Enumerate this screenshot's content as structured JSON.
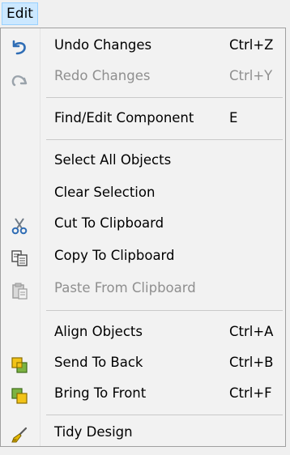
{
  "menubar": {
    "title": "Edit"
  },
  "menu": {
    "items": [
      {
        "label": "Undo Changes",
        "shortcut": "Ctrl+Z",
        "icon": "undo-icon",
        "enabled": true
      },
      {
        "label": "Redo Changes",
        "shortcut": "Ctrl+Y",
        "icon": "redo-icon",
        "enabled": false
      },
      {
        "label": "Find/Edit Component",
        "shortcut": "E",
        "icon": "",
        "enabled": true
      },
      {
        "label": "Select All Objects",
        "shortcut": "",
        "icon": "",
        "enabled": true
      },
      {
        "label": "Clear Selection",
        "shortcut": "",
        "icon": "",
        "enabled": true
      },
      {
        "label": "Cut To Clipboard",
        "shortcut": "",
        "icon": "cut-icon",
        "enabled": true
      },
      {
        "label": "Copy To Clipboard",
        "shortcut": "",
        "icon": "copy-icon",
        "enabled": true
      },
      {
        "label": "Paste From Clipboard",
        "shortcut": "",
        "icon": "paste-icon",
        "enabled": false
      },
      {
        "label": "Align Objects",
        "shortcut": "Ctrl+A",
        "icon": "",
        "enabled": true
      },
      {
        "label": "Send To Back",
        "shortcut": "Ctrl+B",
        "icon": "send-to-back-icon",
        "enabled": true
      },
      {
        "label": "Bring To Front",
        "shortcut": "Ctrl+F",
        "icon": "bring-to-front-icon",
        "enabled": true
      },
      {
        "label": "Tidy Design",
        "shortcut": "",
        "icon": "tidy-design-icon",
        "enabled": true
      }
    ]
  },
  "colors": {
    "menu_bg": "#f2f2f2",
    "highlight": "#cce8ff",
    "disabled_text": "#8f8f8f"
  }
}
